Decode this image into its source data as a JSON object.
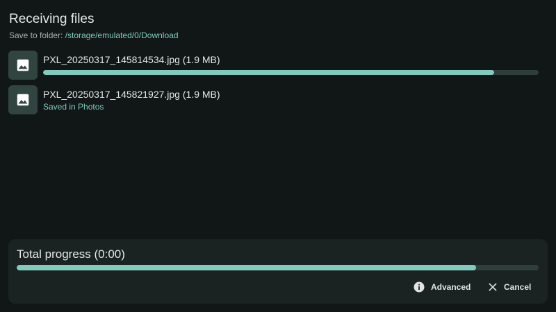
{
  "header": {
    "title": "Receiving files",
    "save_prefix": "Save to folder: ",
    "save_path": "/storage/emulated/0/Download"
  },
  "files": [
    {
      "name": "PXL_20250317_145814534.jpg (1.9 MB)",
      "icon": "image-icon",
      "progress_percent": 91,
      "status": ""
    },
    {
      "name": "PXL_20250317_145821927.jpg (1.9 MB)",
      "icon": "image-icon",
      "progress_percent": 100,
      "status": "Saved in Photos"
    }
  ],
  "total": {
    "label": "Total progress (0:00)",
    "progress_percent": 88
  },
  "actions": {
    "advanced_label": "Advanced",
    "advanced_icon": "info-icon",
    "cancel_label": "Cancel",
    "cancel_icon": "close-icon"
  },
  "colors": {
    "background": "#111716",
    "accent": "#80cbbd",
    "track": "#2e3f3b",
    "card": "#1a2321",
    "thumb": "#314540"
  }
}
